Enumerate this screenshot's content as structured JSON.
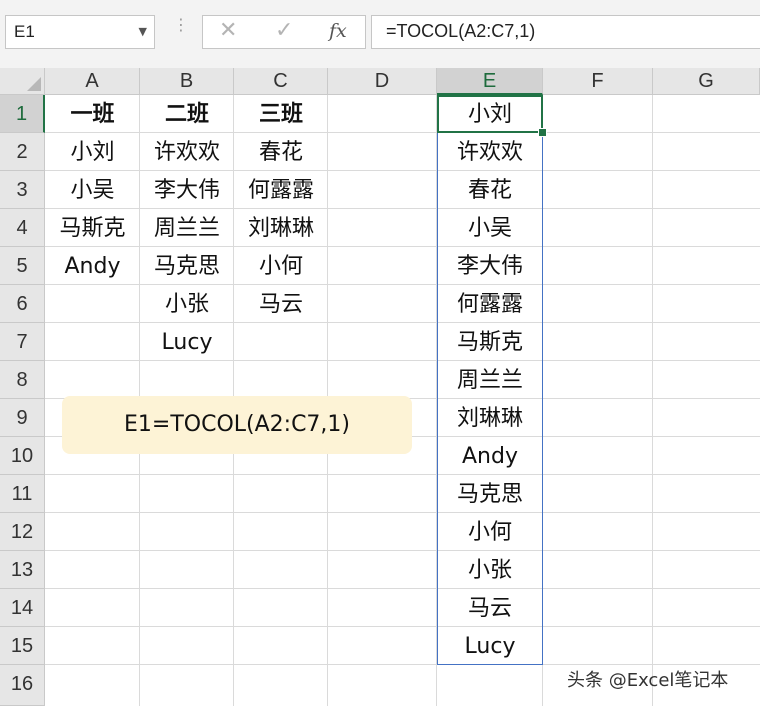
{
  "name_box": "E1",
  "formula_bar": {
    "cancel": "✕",
    "enter": "✓",
    "fx": "fx",
    "formula": "=TOCOL(A2:C7,1)"
  },
  "columns": [
    "A",
    "B",
    "C",
    "D",
    "E",
    "F",
    "G"
  ],
  "rows": [
    "1",
    "2",
    "3",
    "4",
    "5",
    "6",
    "7",
    "8",
    "9",
    "10",
    "11",
    "12",
    "13",
    "14",
    "15",
    "16"
  ],
  "cells": {
    "A": [
      "一班",
      "小刘",
      "小吴",
      "马斯克",
      "Andy"
    ],
    "B": [
      "二班",
      "许欢欢",
      "李大伟",
      "周兰兰",
      "马克思",
      "小张",
      "Lucy"
    ],
    "C": [
      "三班",
      "春花",
      "何露露",
      "刘琳琳",
      "小何",
      "马云"
    ],
    "E": [
      "小刘",
      "许欢欢",
      "春花",
      "小吴",
      "李大伟",
      "何露露",
      "马斯克",
      "周兰兰",
      "刘琳琳",
      "Andy",
      "马克思",
      "小何",
      "小张",
      "马云",
      "Lucy"
    ]
  },
  "note": "E1=TOCOL(A2:C7,1)",
  "watermark": "头条 @Excel笔记本",
  "accent_color": "#217346",
  "spill_border_color": "#4472c4"
}
